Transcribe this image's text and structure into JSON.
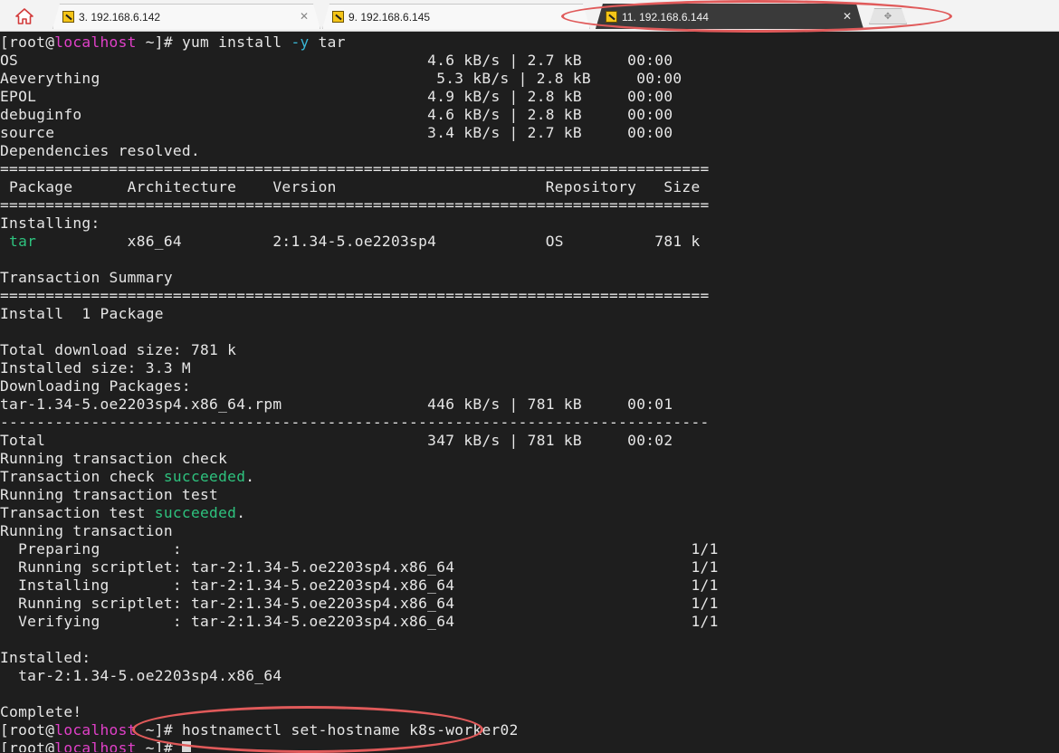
{
  "tabs": [
    {
      "label": "3. 192.168.6.142",
      "state": "inactive"
    },
    {
      "label": "9. 192.168.6.145",
      "state": "inactive"
    },
    {
      "label": "11. 192.168.6.144",
      "state": "active"
    }
  ],
  "icons": {
    "home": "home-icon",
    "tab": "terminal-session-icon",
    "close": "close-icon",
    "new_tab": "new-tab-icon"
  },
  "colors": {
    "terminal_bg": "#1e1e1e",
    "prompt_host": "#e040c8",
    "option_flag": "#39b7d6",
    "success": "#2ec27e",
    "annotation": "#e05a5a"
  },
  "terminal": {
    "prompt": {
      "open": "[root@",
      "host": "localhost",
      "rest": " ~]# "
    },
    "cmd1": {
      "pre": "yum install ",
      "flag": "-y",
      "post": " tar"
    },
    "repos": [
      "OS                                             4.6 kB/s | 2.7 kB     00:00",
      "Aeverything                                     5.3 kB/s | 2.8 kB     00:00",
      "EPOL                                           4.9 kB/s | 2.8 kB     00:00",
      "debuginfo                                      4.6 kB/s | 2.8 kB     00:00",
      "source                                         3.4 kB/s | 2.7 kB     00:00"
    ],
    "deps": "Dependencies resolved.",
    "rule_eq": "==============================================================================",
    "header": " Package      Architecture    Version                       Repository   Size",
    "installing": "Installing:",
    "pkg": {
      "name": " tar",
      "rest": "          x86_64          2:1.34-5.oe2203sp4            OS          781 k"
    },
    "summary": "Transaction Summary",
    "install_count": "Install  1 Package",
    "total_download": "Total download size: 781 k",
    "installed_size": "Installed size: 3.3 M",
    "downloading": "Downloading Packages:",
    "rpm_line": "tar-1.34-5.oe2203sp4.x86_64.rpm                446 kB/s | 781 kB     00:01",
    "rule_dash": "------------------------------------------------------------------------------",
    "total_line": "Total                                          347 kB/s | 781 kB     00:02",
    "run_check": "Running transaction check",
    "check_pre": "Transaction check ",
    "succeeded": "succeeded",
    "dot": ".",
    "run_test": "Running transaction test",
    "test_pre": "Transaction test ",
    "run_tx": "Running transaction",
    "steps": [
      "  Preparing        :                                                        1/1",
      "  Running scriptlet: tar-2:1.34-5.oe2203sp4.x86_64                          1/1",
      "  Installing       : tar-2:1.34-5.oe2203sp4.x86_64                          1/1",
      "  Running scriptlet: tar-2:1.34-5.oe2203sp4.x86_64                          1/1",
      "  Verifying        : tar-2:1.34-5.oe2203sp4.x86_64                          1/1"
    ],
    "installed_head": "Installed:",
    "installed_pkg": "  tar-2:1.34-5.oe2203sp4.x86_64",
    "complete": "Complete!",
    "cmd2": "hostnamectl set-hostname k8s-worker02"
  }
}
